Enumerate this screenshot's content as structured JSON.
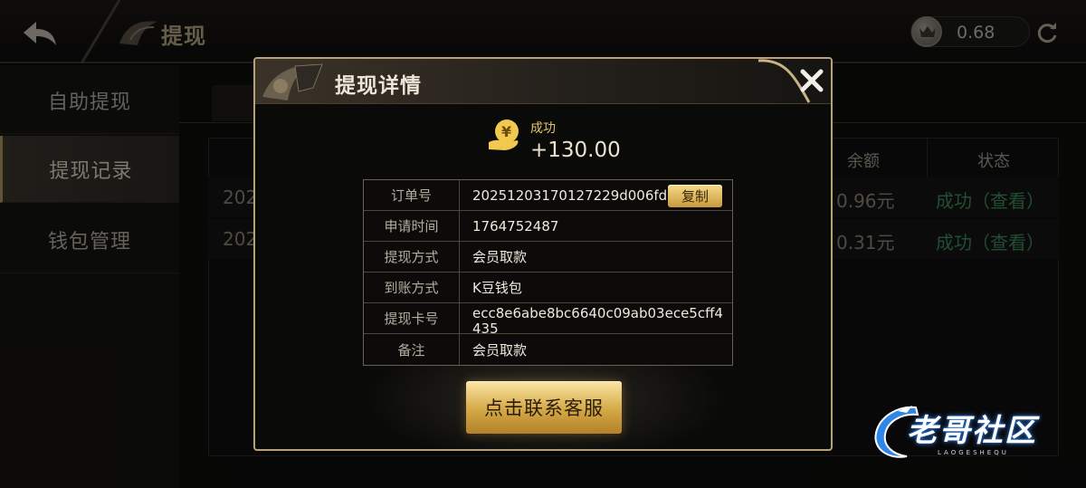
{
  "header": {
    "title": "提现",
    "balance": "0.68"
  },
  "sidebar": {
    "items": [
      {
        "label": "自助提现"
      },
      {
        "label": "提现记录"
      },
      {
        "label": "钱包管理"
      }
    ]
  },
  "table": {
    "columns": [
      "余额",
      "状态"
    ],
    "rows": [
      {
        "time_prefix": "202",
        "balance": "0.96元",
        "status": "成功（查看）"
      },
      {
        "time_prefix": "202",
        "balance": "0.31元",
        "status": "成功（查看）"
      }
    ]
  },
  "dialog": {
    "title": "提现详情",
    "status_label": "成功",
    "amount": "+130.00",
    "details": [
      {
        "label": "订单号",
        "value": "20251203170127229d006fdb..."
      },
      {
        "label": "申请时间",
        "value": "1764752487"
      },
      {
        "label": "提现方式",
        "value": "会员取款"
      },
      {
        "label": "到账方式",
        "value": "K豆钱包"
      },
      {
        "label": "提现卡号",
        "value": "ecc8e6abe8bc6640c09ab03ece5cff4435"
      },
      {
        "label": "备注",
        "value": "会员取款"
      }
    ],
    "copy_label": "复制",
    "contact_label": "点击联系客服"
  },
  "watermark": {
    "text": "老哥社区",
    "subtext": "LAOGESHEQU"
  },
  "colors": {
    "gold_accent": "#b8a277",
    "success_green": "#3d8f5c",
    "button_gold": "#d4a846"
  },
  "icons": [
    "back-arrow-icon",
    "crown-coin-icon",
    "refresh-icon",
    "close-icon",
    "yuan-hand-icon",
    "dragon-logo-icon"
  ]
}
